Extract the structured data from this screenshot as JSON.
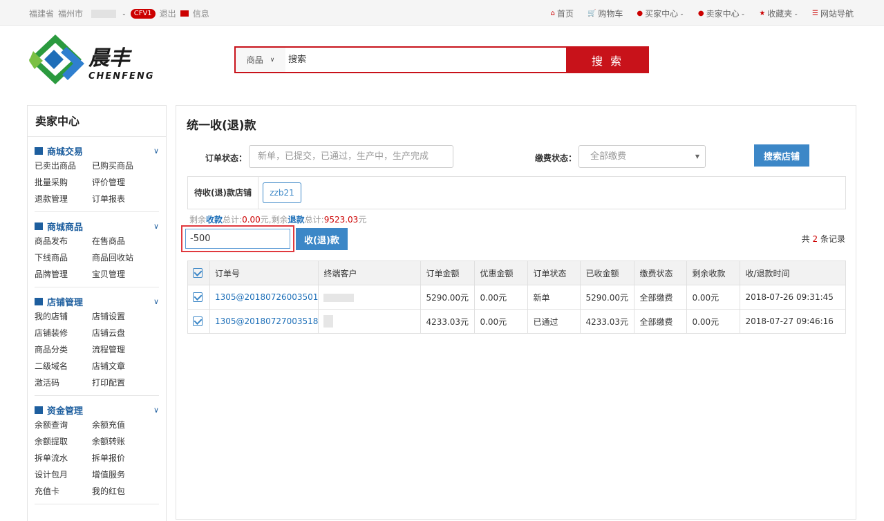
{
  "topbar": {
    "province": "福建省",
    "city": "福州市",
    "badge": "CFV1",
    "logout": "退出",
    "messages": "信息",
    "home": "首页",
    "cart": "购物车",
    "buyer_center": "买家中心",
    "seller_center": "卖家中心",
    "favorites": "收藏夹",
    "site_nav": "网站导航"
  },
  "logo": {
    "cn": "晨丰",
    "en": "CHENFENG"
  },
  "search": {
    "category": "商品",
    "placeholder": "搜索",
    "button": "搜 索"
  },
  "sidebar": {
    "title": "卖家中心",
    "groups": [
      {
        "title": "商城交易",
        "items": [
          "已卖出商品",
          "已购买商品",
          "批量采购",
          "评价管理",
          "退款管理",
          "订单报表"
        ]
      },
      {
        "title": "商城商品",
        "items": [
          "商品发布",
          "在售商品",
          "下线商品",
          "商品回收站",
          "品牌管理",
          "宝贝管理"
        ]
      },
      {
        "title": "店铺管理",
        "items": [
          "我的店铺",
          "店铺设置",
          "店铺装修",
          "店铺云盘",
          "商品分类",
          "流程管理",
          "二级域名",
          "店铺文章",
          "激活码",
          "打印配置"
        ]
      },
      {
        "title": "资金管理",
        "items": [
          "余额查询",
          "余额充值",
          "余额提取",
          "余额转账",
          "拆单流水",
          "拆单报价",
          "设计包月",
          "增值服务",
          "充值卡",
          "我的红包"
        ]
      }
    ]
  },
  "main": {
    "title": "统一收(退)款",
    "order_status_label": "订单状态：",
    "order_status_placeholder": "新单，已提交，已通过，生产中，生产完成",
    "pay_status_label": "缴费状态：",
    "pay_status_value": "全部缴费",
    "search_shop_button": "搜索店铺",
    "shop_label": "待收(退)款店铺",
    "shop_tag": "zzb21",
    "summary": {
      "prefix": "剩余",
      "collect_word": "收款",
      "total1": "总计:",
      "collect_amount": "0.00",
      "unit1": "元,剩余",
      "refund_word": "退款",
      "total2": "总计:",
      "refund_amount": "9523.03",
      "unit2": "元"
    },
    "amount_value": "-500",
    "collect_button": "收(退)款",
    "count_prefix": "共",
    "count_value": "2",
    "count_suffix": "条记录",
    "table": {
      "headers": [
        "订单号",
        "终端客户",
        "订单金额",
        "优惠金额",
        "订单状态",
        "已收金额",
        "缴费状态",
        "剩余收款",
        "收/退款时间"
      ],
      "rows": [
        {
          "order_no": "1305@20180726003501",
          "amount": "5290.00元",
          "discount": "0.00元",
          "status": "新单",
          "received": "5290.00元",
          "pay_status": "全部缴费",
          "remaining": "0.00元",
          "time": "2018-07-26 09:31:45"
        },
        {
          "order_no": "1305@20180727003518",
          "amount": "4233.03元",
          "discount": "0.00元",
          "status": "已通过",
          "received": "4233.03元",
          "pay_status": "全部缴费",
          "remaining": "0.00元",
          "time": "2018-07-27 09:46:16"
        }
      ]
    }
  },
  "colors": {
    "brand_red": "#c8121a",
    "accent_blue": "#3c87c7",
    "link_blue": "#1d6fb8"
  }
}
